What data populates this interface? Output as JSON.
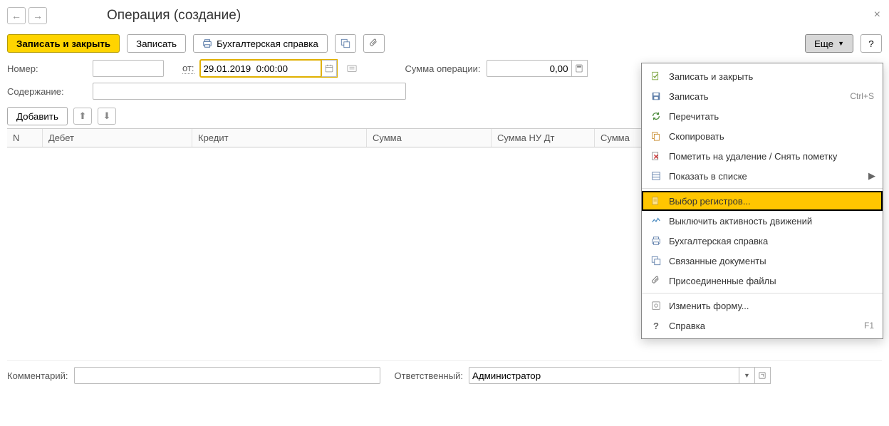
{
  "header": {
    "title": "Операция (создание)"
  },
  "toolbar": {
    "save_close": "Записать и закрыть",
    "save": "Записать",
    "report": "Бухгалтерская справка",
    "more": "Еще",
    "help": "?"
  },
  "fields": {
    "number_label": "Номер:",
    "number_value": "",
    "date_label": "от:",
    "date_value": "29.01.2019  0:00:00",
    "sum_label": "Сумма операции:",
    "sum_value": "0,00",
    "content_label": "Содержание:",
    "content_value": ""
  },
  "table_toolbar": {
    "add": "Добавить"
  },
  "columns": {
    "n": "N",
    "debit": "Дебет",
    "credit": "Кредит",
    "sum": "Сумма",
    "nu_dt": "Сумма НУ Дт",
    "nu": "Сумма"
  },
  "footer": {
    "comment_label": "Комментарий:",
    "comment_value": "",
    "responsible_label": "Ответственный:",
    "responsible_value": "Администратор"
  },
  "menu": {
    "items": [
      {
        "icon": "check-doc-icon",
        "label": "Записать и закрыть",
        "shortcut": ""
      },
      {
        "icon": "save-icon",
        "label": "Записать",
        "shortcut": "Ctrl+S"
      },
      {
        "icon": "refresh-icon",
        "label": "Перечитать",
        "shortcut": ""
      },
      {
        "icon": "copy-icon",
        "label": "Скопировать",
        "shortcut": ""
      },
      {
        "icon": "delete-mark-icon",
        "label": "Пометить на удаление / Снять пометку",
        "shortcut": ""
      },
      {
        "icon": "list-icon",
        "label": "Показать в списке",
        "shortcut": "",
        "submenu": true
      },
      {
        "icon": "registers-icon",
        "label": "Выбор регистров...",
        "shortcut": "",
        "selected": true
      },
      {
        "icon": "activity-icon",
        "label": "Выключить активность движений",
        "shortcut": ""
      },
      {
        "icon": "print-icon",
        "label": "Бухгалтерская справка",
        "shortcut": ""
      },
      {
        "icon": "link-icon",
        "label": "Связанные документы",
        "shortcut": ""
      },
      {
        "icon": "attach-icon",
        "label": "Присоединенные файлы",
        "shortcut": ""
      },
      {
        "icon": "form-icon",
        "label": "Изменить форму...",
        "shortcut": ""
      },
      {
        "icon": "help-icon",
        "label": "Справка",
        "shortcut": "F1"
      }
    ],
    "sep_after": [
      5,
      10
    ]
  }
}
